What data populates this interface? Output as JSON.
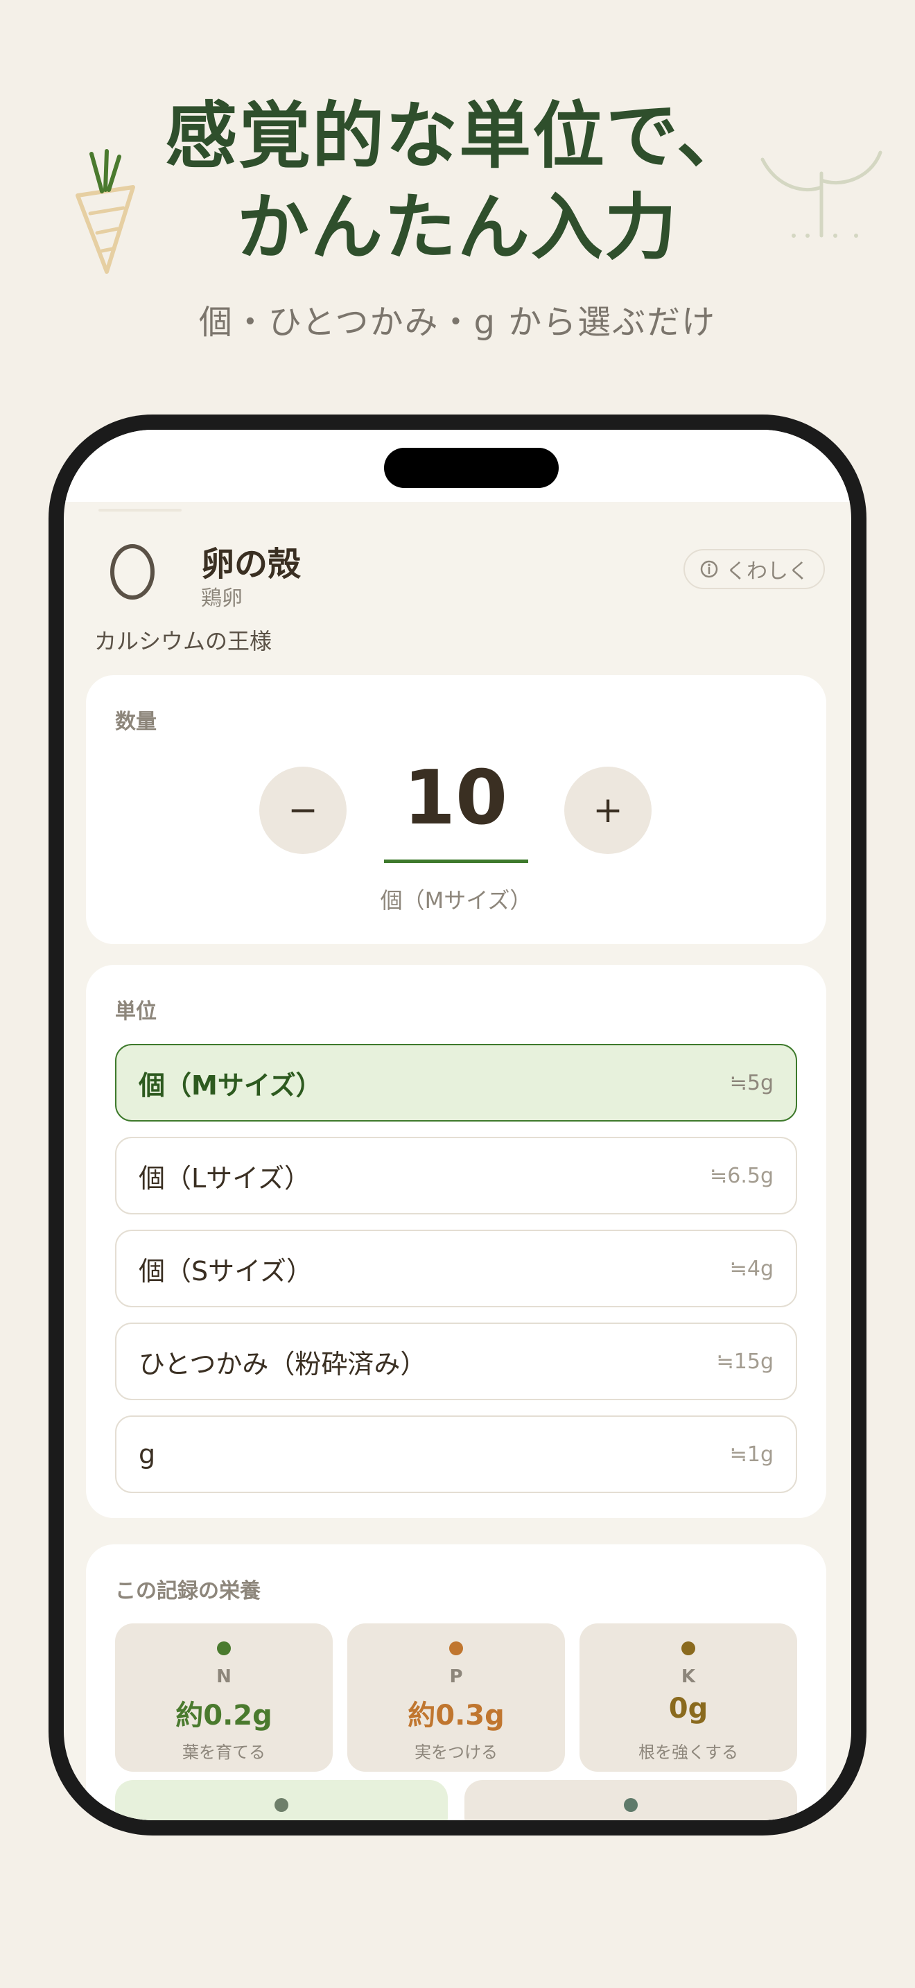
{
  "hero": {
    "title_line1": "感覚的な単位で、",
    "title_line2": "かんたん入力",
    "subtitle": "個・ひとつかみ・g から選ぶだけ"
  },
  "food": {
    "name": "卵の殻",
    "sub": "鶏卵",
    "tagline": "カルシウムの王様",
    "icon": "egg-icon",
    "detail_button": "くわしく",
    "detail_icon": "info-icon"
  },
  "quantity": {
    "label": "数量",
    "decrement": "−",
    "increment": "+",
    "value": "10",
    "unit": "個（Mサイズ）"
  },
  "units": {
    "label": "単位",
    "options": [
      {
        "label": "個（Mサイズ）",
        "amount": "≒5g",
        "selected": true
      },
      {
        "label": "個（Lサイズ）",
        "amount": "≒6.5g",
        "selected": false
      },
      {
        "label": "個（Sサイズ）",
        "amount": "≒4g",
        "selected": false
      },
      {
        "label": "ひとつかみ（粉砕済み）",
        "amount": "≒15g",
        "selected": false
      },
      {
        "label": "g",
        "amount": "≒1g",
        "selected": false
      }
    ]
  },
  "nutrition": {
    "label": "この記録の栄養",
    "items": [
      {
        "letter": "N",
        "value": "約0.2g",
        "desc": "葉を育てる",
        "color": "#4a7a2e"
      },
      {
        "letter": "P",
        "value": "約0.3g",
        "desc": "実をつける",
        "color": "#c0762f"
      },
      {
        "letter": "K",
        "value": "0g",
        "desc": "根を強くする",
        "color": "#8a6a1e"
      }
    ],
    "extra_colors": [
      "#6e7f6a",
      "#5f7a6a"
    ]
  },
  "colors": {
    "accent": "#3e7a2c",
    "background": "#f4f0e8",
    "selected_bg": "#e7f1dc"
  }
}
